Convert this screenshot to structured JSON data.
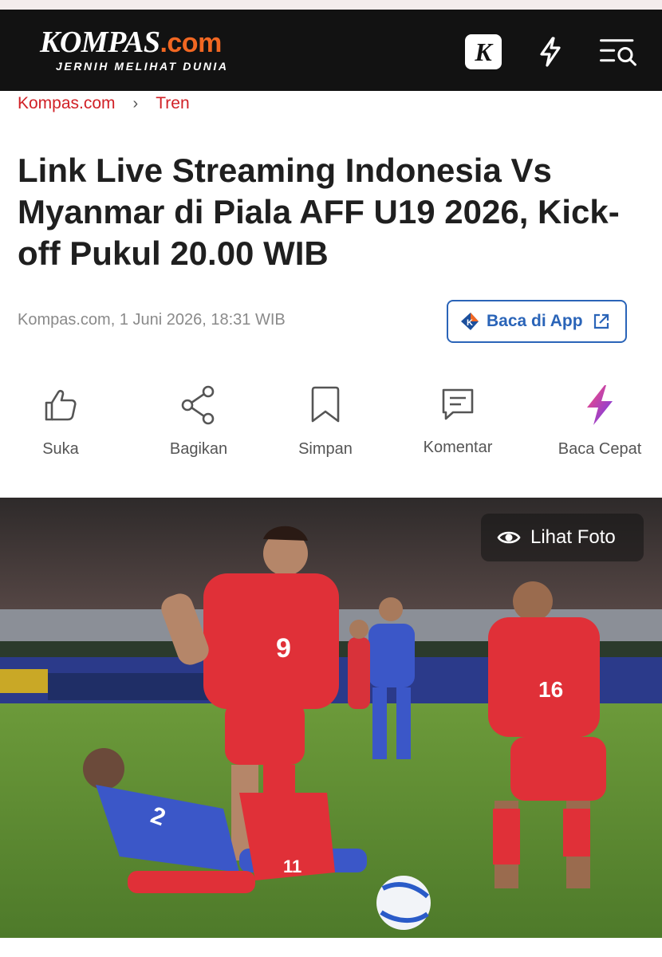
{
  "header": {
    "logo_main": "KOMPAS",
    "logo_suffix": ".com",
    "tagline": "JERNIH MELIHAT DUNIA",
    "k_icon_letter": "K",
    "icons": [
      "k-app-icon",
      "lightning-icon",
      "menu-search-icon"
    ],
    "bg_color": "#121212",
    "accent_color": "#f16722"
  },
  "breadcrumb": {
    "items": [
      "Kompas.com",
      "Tren"
    ],
    "separator": "›",
    "color": "#d12127"
  },
  "article": {
    "title": "Link Live Streaming Indonesia Vs Myanmar di Piala AFF U19 2026, Kick-off Pukul 20.00 WIB",
    "meta": "Kompas.com, 1 Juni 2026, 18:31 WIB",
    "app_button": "Baca di App"
  },
  "actions": [
    {
      "label": "Suka",
      "icon": "thumbs-up-icon"
    },
    {
      "label": "Bagikan",
      "icon": "share-icon"
    },
    {
      "label": "Simpan",
      "icon": "bookmark-icon"
    },
    {
      "label": "Komentar",
      "icon": "comment-icon"
    },
    {
      "label": "Baca Cepat",
      "icon": "lightning-gradient-icon"
    }
  ],
  "photo": {
    "button": "Lihat Foto",
    "jersey_numbers": [
      "9",
      "16",
      "2",
      "11"
    ]
  }
}
